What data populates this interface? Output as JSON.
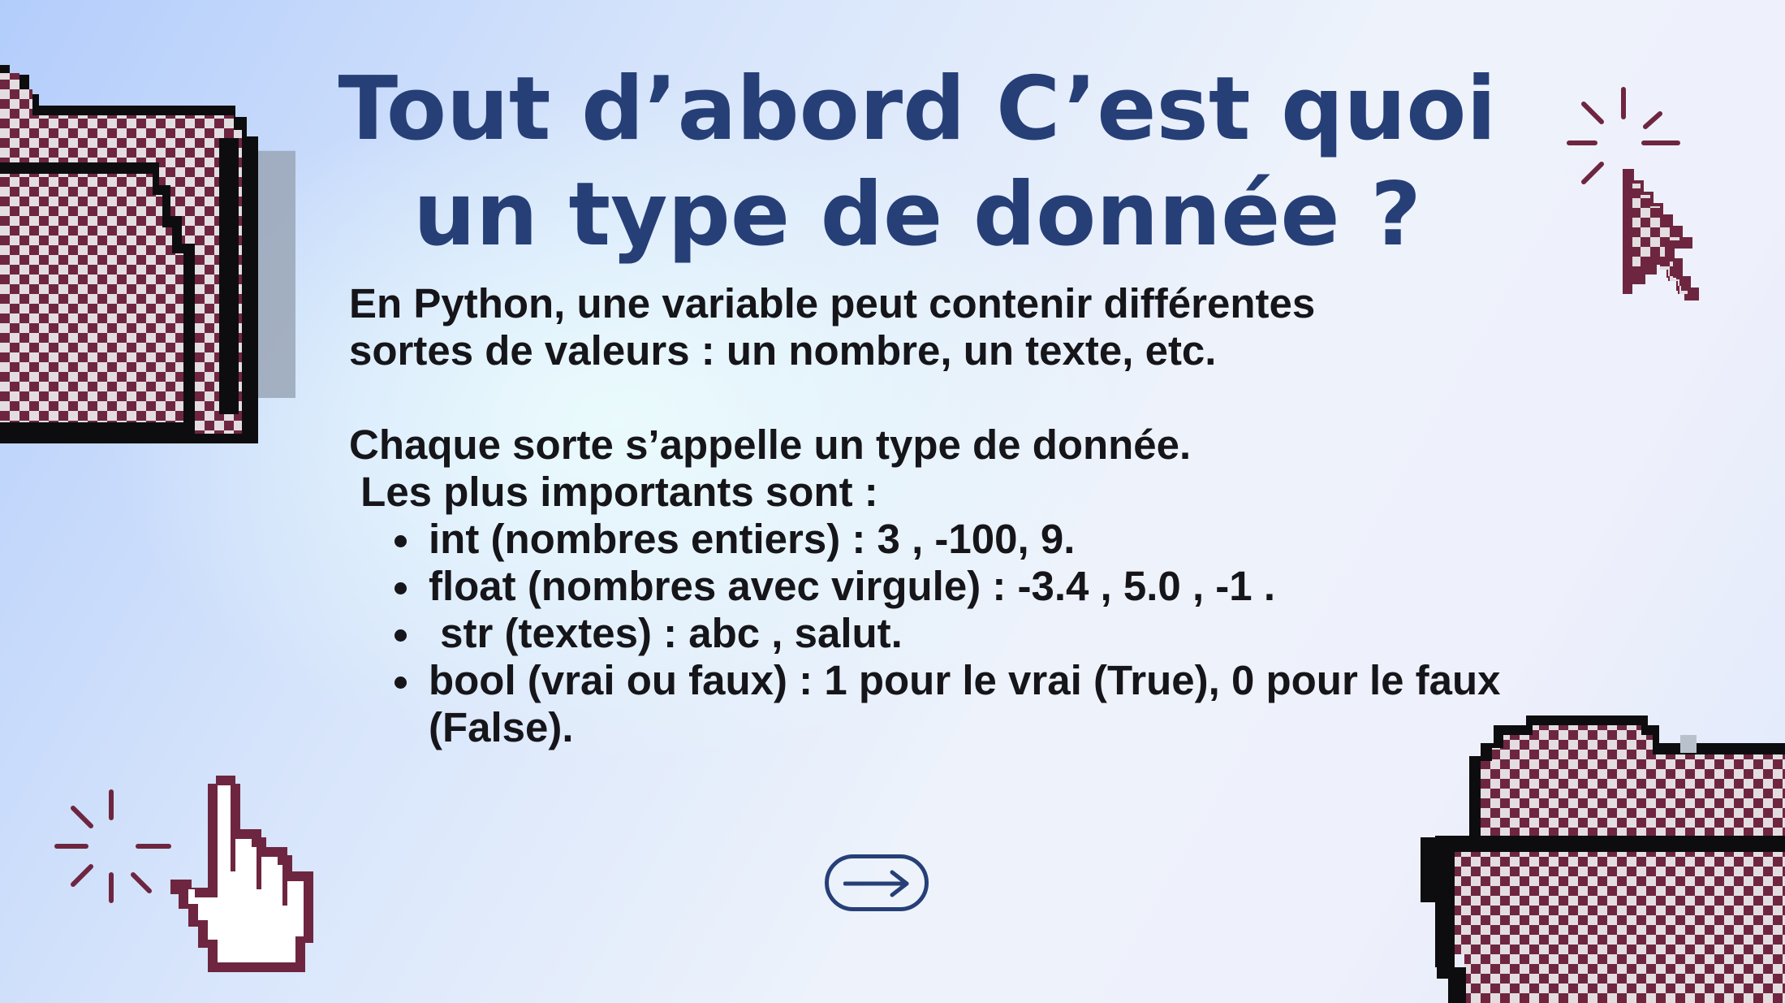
{
  "slide": {
    "title_line1": "Tout d’abord C’est quoi",
    "title_line2": "un type de donnée ?",
    "intro_line1": "En Python, une variable peut contenir différentes",
    "intro_line2": "sortes de valeurs : un nombre, un texte, etc.",
    "types_line1": "Chaque sorte s’appelle un type de donnée.",
    "types_line2": " Les plus importants sont :",
    "items": [
      "int (nombres entiers) : 3 , -100, 9.",
      "float (nombres avec virgule) : -3.4 , 5.0 , -1 .",
      " str (textes) : abc , salut.",
      "bool (vrai ou faux) : 1 pour le vrai (True), 0 pour le faux (False)."
    ]
  },
  "icons": {
    "next": "arrow-right-icon",
    "folder": "pixel-folder-icon",
    "cursor": "pixel-cursor-icon",
    "hand": "pixel-hand-pointer-icon"
  },
  "colors": {
    "title": "#263f77",
    "text": "#15151a",
    "pixel_maroon": "#6e2640",
    "pixel_light": "#e3dde0"
  }
}
